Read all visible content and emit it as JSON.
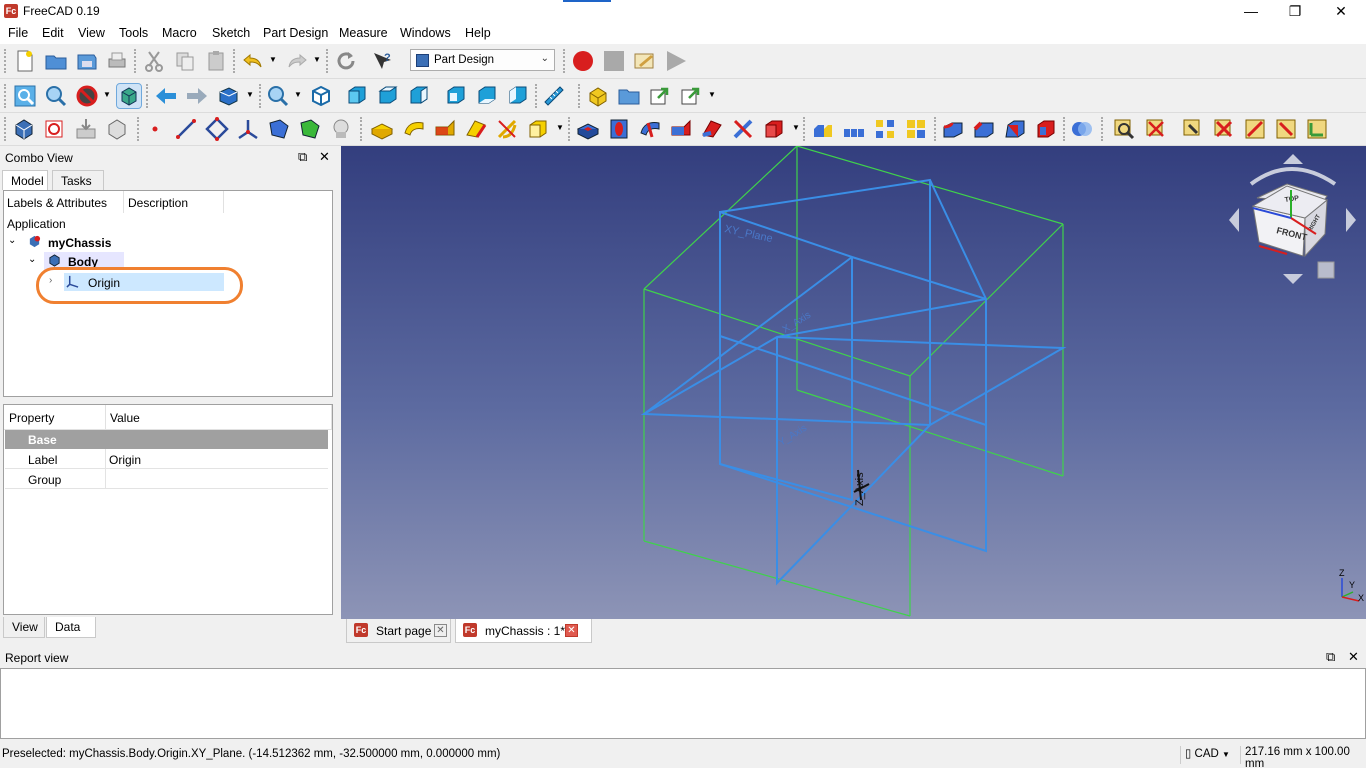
{
  "window": {
    "title": "FreeCAD 0.19",
    "minimize": "—",
    "maximize": "❐",
    "close": "✕"
  },
  "menu": [
    "File",
    "Edit",
    "View",
    "Tools",
    "Macro",
    "Sketch",
    "Part Design",
    "Measure",
    "Windows",
    "Help"
  ],
  "workbench": {
    "selected": "Part Design"
  },
  "combo_view": {
    "title": "Combo View",
    "tabs": [
      "Model",
      "Tasks"
    ],
    "tree": {
      "col_labels": "Labels & Attributes",
      "col_description": "Description",
      "application": "Application",
      "document": "myChassis",
      "body": "Body",
      "origin": "Origin"
    },
    "properties": {
      "col_property": "Property",
      "col_value": "Value",
      "group": "Base",
      "rows": [
        {
          "name": "Label",
          "value": "Origin"
        },
        {
          "name": "Group",
          "value": ""
        }
      ]
    },
    "bottom_tabs": [
      "View",
      "Data"
    ]
  },
  "viewport": {
    "labels": {
      "xy_plane": "XY_Plane",
      "x_axis": "X_Axis",
      "y_axis": "Y_Axis",
      "z_axis": "Z_Axis"
    },
    "nav_cube": {
      "top": "TOP",
      "front": "FRONT",
      "right": "RIGHT"
    },
    "axis_cross": {
      "x": "X",
      "y": "Y",
      "z": "Z"
    },
    "colors": {
      "plane_blue": "#3a8ee6",
      "frame_green": "#3fd24b",
      "bg_top": "#333e7e",
      "bg_bottom": "#8d94b6"
    }
  },
  "doc_tabs": [
    {
      "label": "Start page"
    },
    {
      "label": "myChassis : 1*"
    }
  ],
  "report_view": {
    "title": "Report view"
  },
  "status": {
    "message": "Preselected: myChassis.Body.Origin.XY_Plane. (-14.512362 mm, -32.500000 mm, 0.000000 mm)",
    "nav_style": "CAD",
    "dimensions": "217.16 mm x 100.00 mm"
  }
}
